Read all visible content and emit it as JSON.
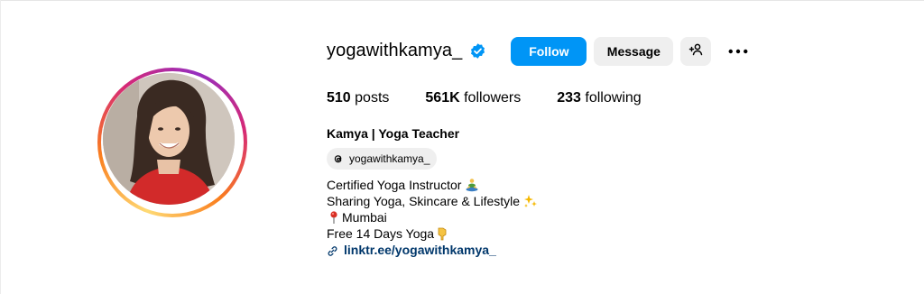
{
  "profile": {
    "username": "yogawithkamya_",
    "verified": true,
    "full_name": "Kamya | Yoga Teacher",
    "threads_handle": "yogawithkamya_",
    "bio_lines": [
      "Certified Yoga Instructor",
      "Sharing Yoga, Skincare & Lifestyle",
      "Mumbai",
      "Free 14 Days Yoga"
    ],
    "link": "linktr.ee/yogawithkamya_"
  },
  "actions": {
    "follow_label": "Follow",
    "message_label": "Message"
  },
  "stats": {
    "posts_count": "510",
    "posts_label": "posts",
    "followers_count": "561K",
    "followers_label": "followers",
    "following_count": "233",
    "following_label": "following"
  },
  "icons": {
    "verified": "verified-badge-icon",
    "suggest": "add-person-icon",
    "more": "more-options-icon",
    "threads": "threads-icon",
    "link": "link-icon"
  },
  "colors": {
    "accent": "#0095f6",
    "verified": "#0095f6",
    "secondary_button": "#efefef",
    "link": "#00376b"
  }
}
